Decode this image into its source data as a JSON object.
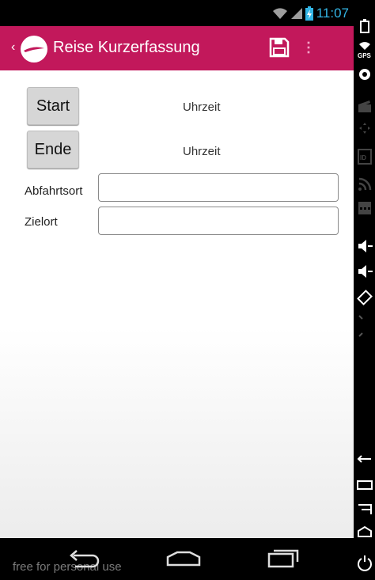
{
  "status_bar": {
    "time": "11:07"
  },
  "action_bar": {
    "title": "Reise Kurzerfassung"
  },
  "form": {
    "start_button": "Start",
    "start_time": "Uhrzeit",
    "end_button": "Ende",
    "end_time": "Uhrzeit",
    "departure_label": "Abfahrtsort",
    "departure_value": "",
    "destination_label": "Zielort",
    "destination_value": ""
  },
  "nav_bar": {
    "watermark": "free for personal use"
  },
  "side_panel": {
    "gps_label": "GPS",
    "id_label": "ID"
  },
  "colors": {
    "accent": "#c2185b",
    "status_text": "#33b5e5"
  }
}
